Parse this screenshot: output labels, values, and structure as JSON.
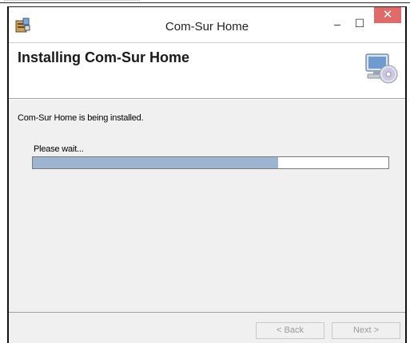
{
  "window": {
    "title": "Com-Sur Home",
    "controls": {
      "minimize": "–",
      "maximize": "☐",
      "close": "✕"
    }
  },
  "header": {
    "title": "Installing Com-Sur Home",
    "icon": "computer-disc-icon"
  },
  "body": {
    "status_text": "Com-Sur Home is being installed.",
    "wait_label": "Please wait...",
    "progress_fraction": 0.69
  },
  "footer": {
    "back_label": "< Back",
    "next_label": "Next >"
  },
  "colors": {
    "progress_fill": "#9db5d0",
    "close_button": "#e06a6a",
    "panel_background": "#f0f0f0"
  }
}
